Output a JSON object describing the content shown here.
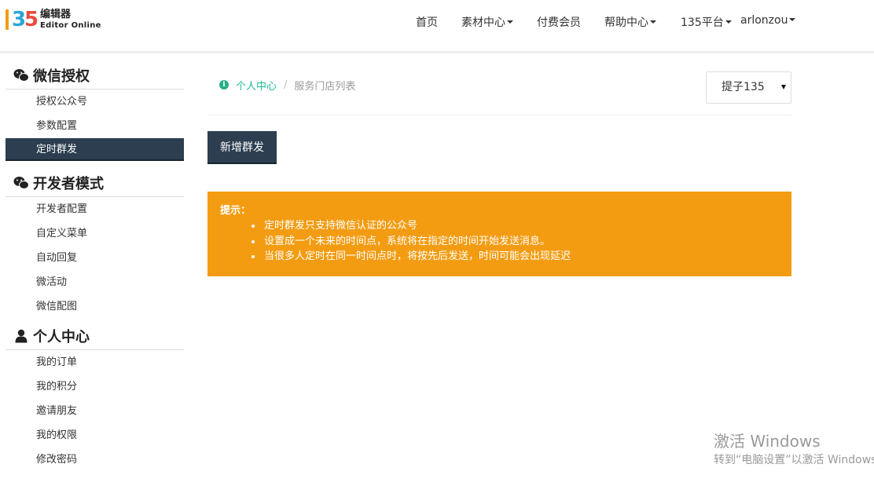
{
  "app": {
    "logo_cn": "编辑器",
    "logo_en": "Editor Online"
  },
  "nav": {
    "home": "首页",
    "materials": "素材中心",
    "vip": "付费会员",
    "help": "帮助中心",
    "platform": "135平台",
    "user": "arlonzou"
  },
  "sidebar": {
    "groups": [
      {
        "title": "微信授权",
        "icon": "wechat-icon",
        "items": [
          {
            "label": "授权公众号",
            "active": false
          },
          {
            "label": "参数配置",
            "active": false
          },
          {
            "label": "定时群发",
            "active": true
          }
        ]
      },
      {
        "title": "开发者模式",
        "icon": "wechat-icon",
        "items": [
          {
            "label": "开发者配置",
            "active": false
          },
          {
            "label": "自定义菜单",
            "active": false
          },
          {
            "label": "自动回复",
            "active": false
          },
          {
            "label": "微活动",
            "active": false
          },
          {
            "label": "微信配图",
            "active": false
          }
        ]
      },
      {
        "title": "个人中心",
        "icon": "user-icon",
        "items": [
          {
            "label": "我的订单",
            "active": false
          },
          {
            "label": "我的积分",
            "active": false
          },
          {
            "label": "邀请朋友",
            "active": false
          },
          {
            "label": "我的权限",
            "active": false
          },
          {
            "label": "修改密码",
            "active": false
          }
        ]
      }
    ]
  },
  "breadcrumb": {
    "icon": "info-icon",
    "link": "个人中心",
    "separator": "/",
    "current": "服务门店列表"
  },
  "account_select": {
    "selected": "提子135"
  },
  "actions": {
    "new_button": "新增群发"
  },
  "tip": {
    "title": "提示：",
    "items": [
      "定时群发只支持微信认证的公众号",
      "设置成一个未来的时间点，系统将在指定的时间开始发送消息。",
      "当很多人定时在同一时间点时，将按先后发送，时间可能会出现延迟"
    ]
  },
  "watermark": {
    "title": "激活 Windows",
    "subtitle": "转到“电脑设置”以激活 Windows。"
  },
  "colors": {
    "dark_navy": "#2c3e50",
    "warning_orange": "#f39c12",
    "link_teal": "#1abc9c"
  }
}
